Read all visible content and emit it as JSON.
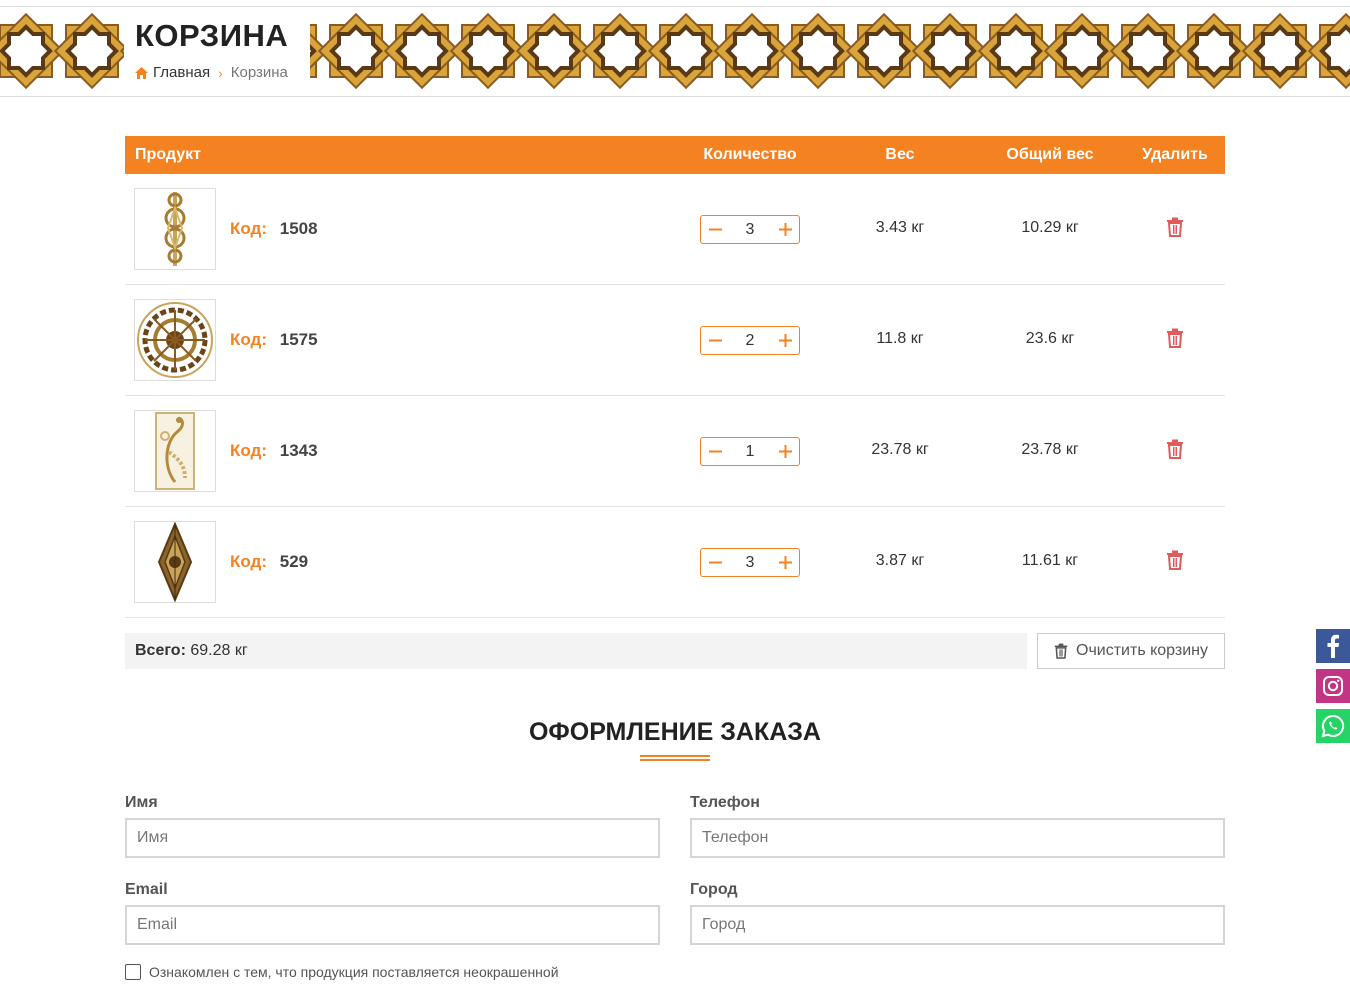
{
  "header": {
    "title": "КОРЗИНА",
    "breadcrumb": {
      "home": "Главная",
      "separator": "›",
      "current": "Корзина"
    }
  },
  "cart": {
    "columns": {
      "product": "Продукт",
      "quantity": "Количество",
      "weight": "Вес",
      "total_weight": "Общий вес",
      "delete": "Удалить"
    },
    "code_label": "Код:",
    "items": [
      {
        "code": "1508",
        "quantity": "3",
        "weight": "3.43 кг",
        "total_weight": "10.29 кг",
        "image_icon": "ornament-vertical-icon"
      },
      {
        "code": "1575",
        "quantity": "2",
        "weight": "11.8 кг",
        "total_weight": "23.6 кг",
        "image_icon": "ornament-round-icon"
      },
      {
        "code": "1343",
        "quantity": "1",
        "weight": "23.78 кг",
        "total_weight": "23.78 кг",
        "image_icon": "ornament-peacock-icon"
      },
      {
        "code": "529",
        "quantity": "3",
        "weight": "3.87 кг",
        "total_weight": "11.61 кг",
        "image_icon": "ornament-diamond-icon"
      }
    ],
    "summary": {
      "label": "Всего:",
      "value": "69.28 кг"
    },
    "clear_button": "Очистить корзину"
  },
  "order": {
    "title": "ОФОРМЛЕНИЕ ЗАКАЗА",
    "fields": {
      "name": {
        "label": "Имя",
        "placeholder": "Имя"
      },
      "phone": {
        "label": "Телефон",
        "placeholder": "Телефон"
      },
      "email": {
        "label": "Email",
        "placeholder": "Email"
      },
      "city": {
        "label": "Город",
        "placeholder": "Город"
      }
    },
    "agreement": "Ознакомлен с тем, что продукция поставляется неокрашенной"
  },
  "colors": {
    "accent": "#f58220",
    "gold": "#d9a43a",
    "brown": "#5a3a16",
    "facebook": "#3b5998",
    "instagram": "#c13584",
    "whatsapp": "#25d366"
  },
  "social": [
    "facebook-icon",
    "instagram-icon",
    "whatsapp-icon"
  ]
}
